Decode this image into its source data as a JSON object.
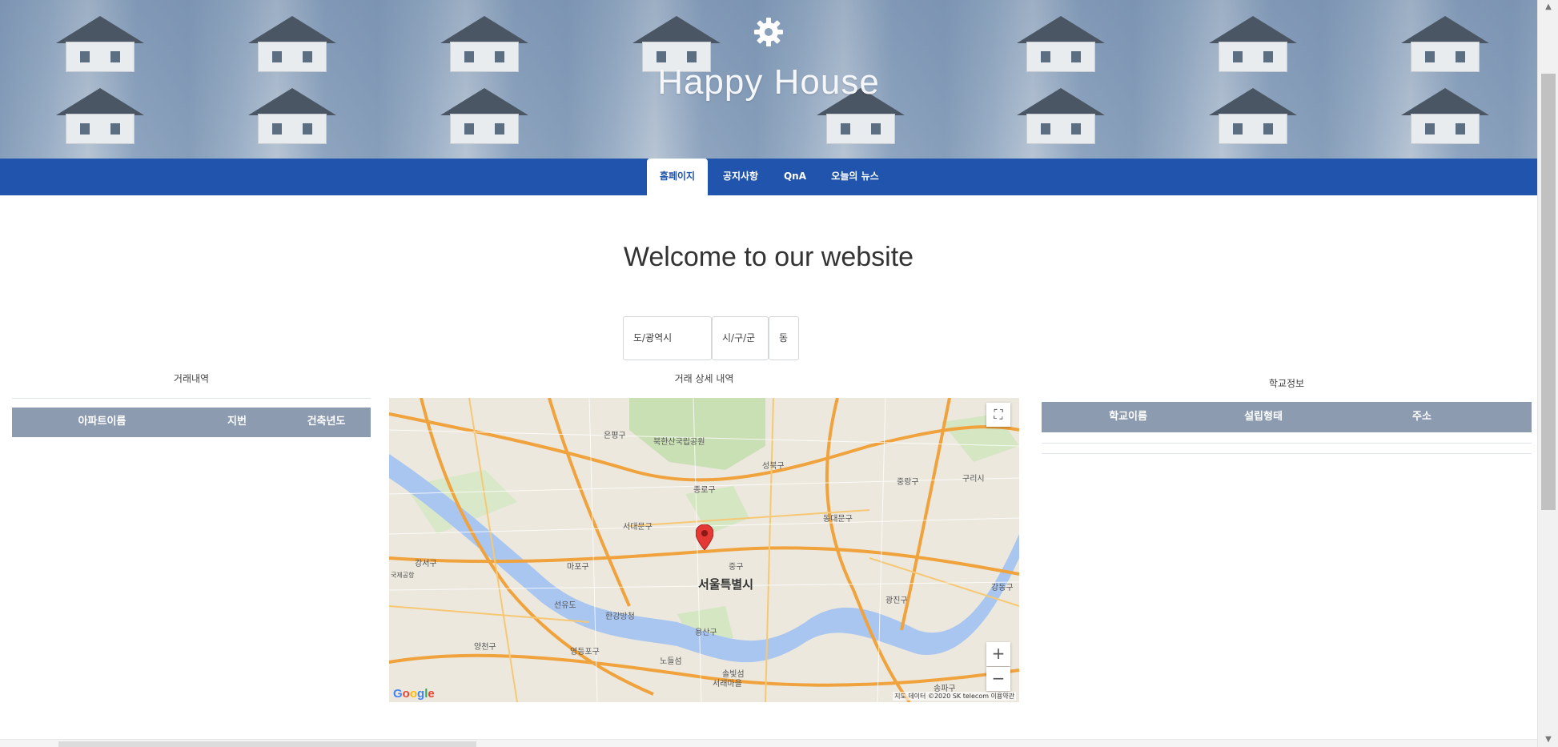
{
  "header": {
    "title": "Happy House",
    "icon": "gear-icon"
  },
  "nav": {
    "items": [
      {
        "label": "홈페이지",
        "active": true
      },
      {
        "label": "공지사항",
        "active": false
      },
      {
        "label": "QnA",
        "active": false
      },
      {
        "label": "오늘의 뉴스",
        "active": false
      }
    ]
  },
  "main": {
    "welcome": "Welcome to our website"
  },
  "search": {
    "province": "도/광역시",
    "city": "시/구/군",
    "dong": "동"
  },
  "deals": {
    "heading": "거래내역",
    "columns": [
      "아파트이름",
      "지번",
      "건축년도"
    ]
  },
  "detail": {
    "heading": "거래 상세 내역"
  },
  "schools": {
    "heading": "학교정보",
    "columns": [
      "학교이름",
      "설립형태",
      "주소"
    ]
  },
  "map": {
    "city_label": "서울특별시",
    "district_labels": [
      "은평구",
      "북한산국립공원",
      "성북구",
      "종로구",
      "중랑구",
      "구리시",
      "서대문구",
      "동대문구",
      "중구",
      "마포구",
      "강서구",
      "광진구",
      "강동구",
      "용산구",
      "한강방청",
      "선유도",
      "양천구",
      "영등포구",
      "노들섬",
      "송파구",
      "서래마을",
      "솔빛섬",
      "국제공항"
    ],
    "footer": "지도 데이터 ©2020 SK telecom    이용약관",
    "logo": "Google",
    "zoom_in": "+",
    "zoom_out": "−",
    "fullscreen_icon": "fullscreen-icon",
    "marker_color": "#e53935"
  },
  "colors": {
    "nav": "#2155ad",
    "table_header": "#8c9bb0"
  }
}
